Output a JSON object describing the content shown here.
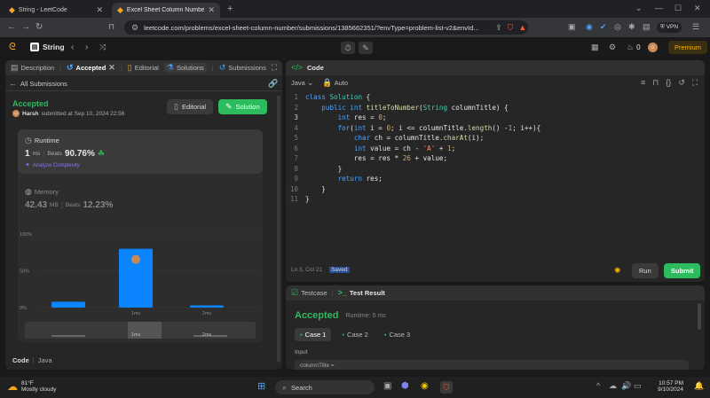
{
  "browser": {
    "tabs": [
      {
        "title": "String - LeetCode"
      },
      {
        "title": "Excel Sheet Column Number - L"
      }
    ],
    "new_tab_symbol": "+",
    "url": "leetcode.com/problems/excel-sheet-column-number/submissions/1385662351/?envType=problem-list-v2&envId...",
    "vpn_label": "VPN"
  },
  "nav": {
    "problem_list": "String",
    "fire_count": "0",
    "premium": "Premium"
  },
  "left": {
    "tabs": [
      "Description",
      "Accepted",
      "Editorial",
      "Solutions",
      "Submissions"
    ],
    "back_label": "All Submissions",
    "status": "Accepted",
    "user": "Harsh",
    "submitted": "submitted at Sep 10, 2024 22:56",
    "editorial_btn": "Editorial",
    "solution_btn": "Solution",
    "runtime": {
      "label": "Runtime",
      "value": "1",
      "unit": "ms",
      "beats_label": "Beats",
      "beats": "90.76%",
      "analyze": "Analyze Complexity"
    },
    "memory": {
      "label": "Memory",
      "value": "42.43",
      "unit": "MB",
      "beats_label": "Beats",
      "beats": "12.23%"
    },
    "code_label": "Code",
    "code_lang": "Java"
  },
  "chart_data": {
    "type": "bar",
    "y_ticks": [
      "100%",
      "50%",
      "0%"
    ],
    "ylim": [
      0,
      100
    ],
    "x_tick_labels": [
      "1ms",
      "2ms"
    ],
    "values": [
      8,
      80,
      3
    ],
    "highlight_index": 1,
    "minimap_labels": [
      "1ms",
      "2ms"
    ]
  },
  "code": {
    "title": "Code",
    "lang": "Java",
    "mode": "Auto",
    "lines": [
      "class Solution {",
      "    public int titleToNumber(String columnTitle) {",
      "        int res = 0;",
      "        for(int i = 0; i <= columnTitle.length() -1; i++){",
      "            char ch = columnTitle.charAt(i);",
      "            int value = ch - 'A' + 1;",
      "            res = res * 26 + value;",
      "        }",
      "        return res;",
      "    }",
      "}"
    ],
    "cursor": "Ln 3, Col 21",
    "saved": "Saved",
    "run": "Run",
    "submit": "Submit"
  },
  "test": {
    "tab1": "Testcase",
    "tab2": "Test Result",
    "status": "Accepted",
    "runtime": "Runtime: 0 ms",
    "cases": [
      "Case 1",
      "Case 2",
      "Case 3"
    ],
    "input_label": "Input",
    "input_var": "columnTitle ="
  },
  "taskbar": {
    "temp": "81°F",
    "weather": "Mostly cloudy",
    "search": "Search",
    "time": "10:57 PM",
    "date": "9/10/2024"
  },
  "colors": {
    "accent_green": "#2cbb5d",
    "accent_blue": "#0a84ff",
    "premium": "#f5b400"
  }
}
